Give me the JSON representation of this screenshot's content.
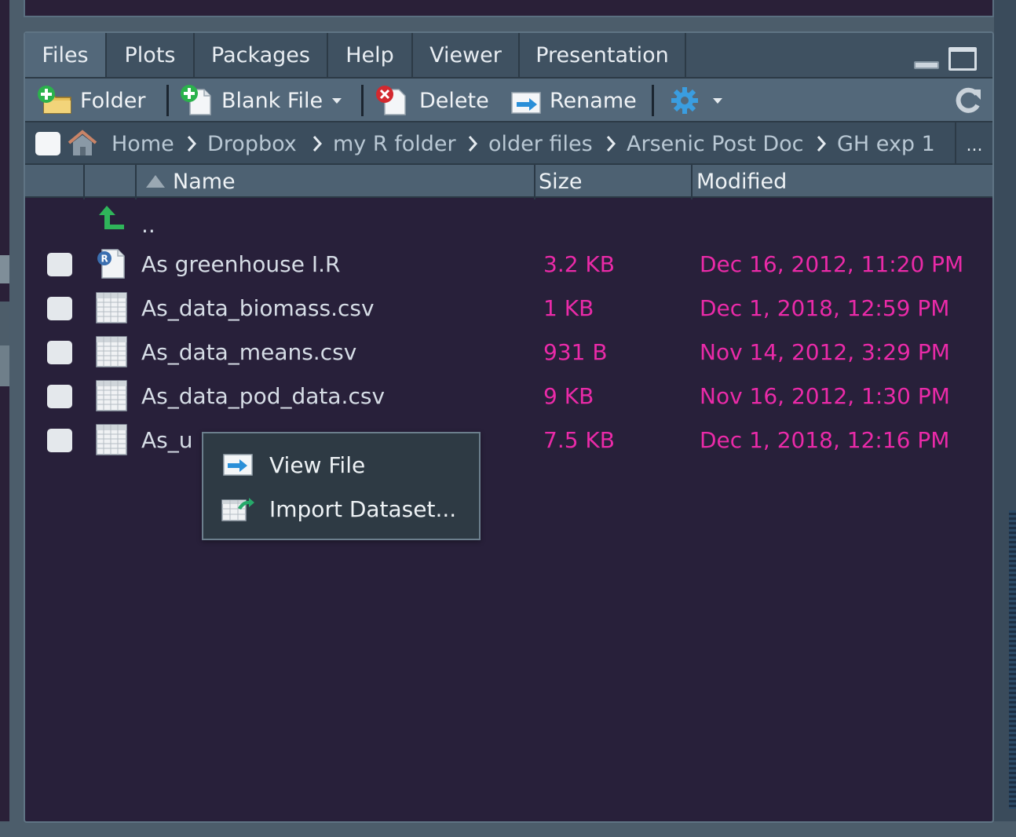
{
  "tabs": [
    {
      "label": "Files",
      "active": true
    },
    {
      "label": "Plots",
      "active": false
    },
    {
      "label": "Packages",
      "active": false
    },
    {
      "label": "Help",
      "active": false
    },
    {
      "label": "Viewer",
      "active": false
    },
    {
      "label": "Presentation",
      "active": false
    }
  ],
  "toolbar": {
    "new_folder_label": "Folder",
    "blank_file_label": "Blank File",
    "delete_label": "Delete",
    "rename_label": "Rename"
  },
  "breadcrumb": {
    "items": [
      "Home",
      "Dropbox",
      "my R folder",
      "older files",
      "Arsenic Post Doc",
      "GH exp 1"
    ],
    "more": "..."
  },
  "columns": {
    "name": "Name",
    "size": "Size",
    "modified": "Modified",
    "sort": "ascending"
  },
  "parent_dir": "..",
  "files": [
    {
      "name": "As greenhouse I.R",
      "size": "3.2 KB",
      "modified": "Dec 16, 2012, 11:20 PM",
      "icon": "r-script-icon"
    },
    {
      "name": "As_data_biomass.csv",
      "size": "1 KB",
      "modified": "Dec 1, 2018, 12:59 PM",
      "icon": "csv-file-icon"
    },
    {
      "name": "As_data_means.csv",
      "size": "931 B",
      "modified": "Nov 14, 2012, 3:29 PM",
      "icon": "csv-file-icon"
    },
    {
      "name": "As_data_pod_data.csv",
      "size": "9 KB",
      "modified": "Nov 16, 2012, 1:30 PM",
      "icon": "csv-file-icon"
    },
    {
      "name": "As_u",
      "size": "7.5 KB",
      "modified": "Dec 1, 2018, 12:16 PM",
      "icon": "csv-file-icon"
    }
  ],
  "context_menu": {
    "items": [
      "View File",
      "Import Dataset..."
    ]
  },
  "colors": {
    "pane_bg": "#28203a",
    "accent_pink": "#ea2aa8",
    "toolbar_bg": "#53687a"
  }
}
